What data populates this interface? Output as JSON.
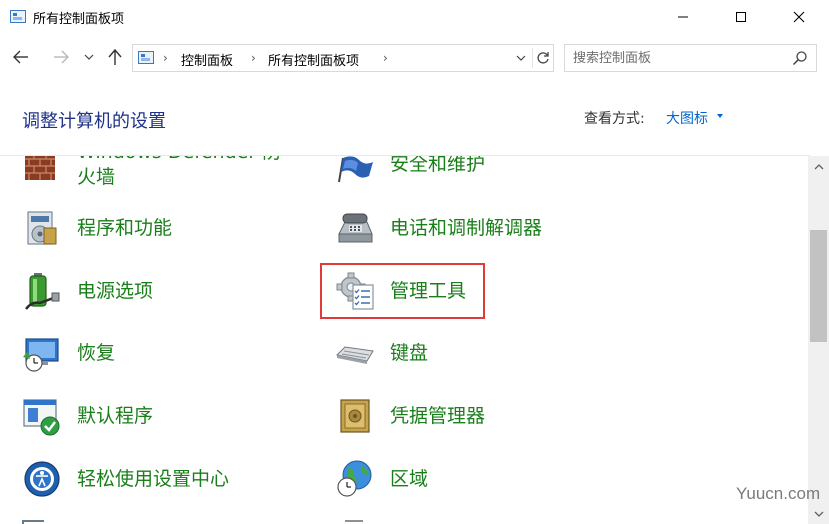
{
  "window": {
    "title": "所有控制面板项",
    "icons": {
      "app": "control-panel-icon",
      "minimize": "minimize-icon",
      "maximize": "maximize-icon",
      "close": "close-icon"
    }
  },
  "nav": {
    "breadcrumb": [
      "控制面板",
      "所有控制面板项"
    ],
    "search_placeholder": "搜索控制面板",
    "icons": {
      "back": "back-arrow-icon",
      "forward": "forward-arrow-icon",
      "recent": "chevron-down-icon",
      "up": "up-arrow-icon",
      "refresh": "refresh-icon",
      "search": "search-icon"
    }
  },
  "header": {
    "title": "调整计算机的设置",
    "view_by_label": "查看方式:",
    "view_by_value": "大图标"
  },
  "items": [
    {
      "label": "Windows Defender 防火墙",
      "icon": "firewall-icon"
    },
    {
      "label": "安全和维护",
      "icon": "security-flag-icon"
    },
    {
      "label": "程序和功能",
      "icon": "programs-icon"
    },
    {
      "label": "电话和调制解调器",
      "icon": "phone-modem-icon"
    },
    {
      "label": "电源选项",
      "icon": "power-battery-icon"
    },
    {
      "label": "管理工具",
      "icon": "admin-tools-icon"
    },
    {
      "label": "恢复",
      "icon": "recovery-icon"
    },
    {
      "label": "键盘",
      "icon": "keyboard-icon"
    },
    {
      "label": "默认程序",
      "icon": "default-programs-icon"
    },
    {
      "label": "凭据管理器",
      "icon": "credential-vault-icon"
    },
    {
      "label": "轻松使用设置中心",
      "icon": "ease-of-access-icon"
    },
    {
      "label": "区域",
      "icon": "region-globe-icon"
    }
  ],
  "colors": {
    "link_green": "#1a7f1a",
    "title_blue": "#1e3287",
    "accent_blue": "#0066cc",
    "highlight_red": "#e13a3a"
  },
  "watermark": "Yuucn.com"
}
